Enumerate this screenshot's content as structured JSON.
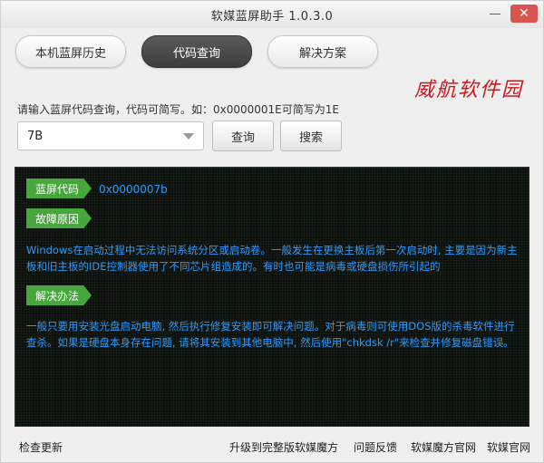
{
  "window": {
    "title": "软媒蓝屏助手 1.0.3.0",
    "minimize_glyph": "—",
    "close_glyph": "✕"
  },
  "tabs": [
    {
      "label": "本机蓝屏历史"
    },
    {
      "label": "代码查询",
      "active": true
    },
    {
      "label": "解决方案"
    }
  ],
  "watermark": "威航软件园",
  "query": {
    "hint": "请输入蓝屏代码查询，代码可简写。如：0x0000001E可简写为1E",
    "selected_value": "7B",
    "query_button": "查询",
    "search_button": "搜索"
  },
  "result": {
    "code_tag": "蓝屏代码",
    "code_value": "0x0000007b",
    "cause_tag": "故障原因",
    "cause_text": "Windows在启动过程中无法访问系统分区或启动卷。一般发生在更换主板后第一次启动时, 主要是因为新主板和旧主板的IDE控制器使用了不同芯片组造成的。有时也可能是病毒或硬盘损伤所引起的",
    "solution_tag": "解决办法",
    "solution_text": "一般只要用安装光盘启动电脑, 然后执行修复安装即可解决问题。对于病毒则可使用DOS版的杀毒软件进行查杀。如果是硬盘本身存在问题, 请将其安装到其他电脑中, 然后使用\"chkdsk /r\"来检查并修复磁盘错误。"
  },
  "footer": {
    "check_update": "检查更新",
    "upgrade": "升级到完整版软媒魔方",
    "feedback": "问题反馈",
    "mofang_site": "软媒魔方官网",
    "ruanmei_site": "软媒官网"
  },
  "colors": {
    "accent_tab": "#4a4a4a",
    "tag_green": "#47a73d",
    "text_blue": "#2e9bff",
    "close_red": "#d9534f"
  }
}
